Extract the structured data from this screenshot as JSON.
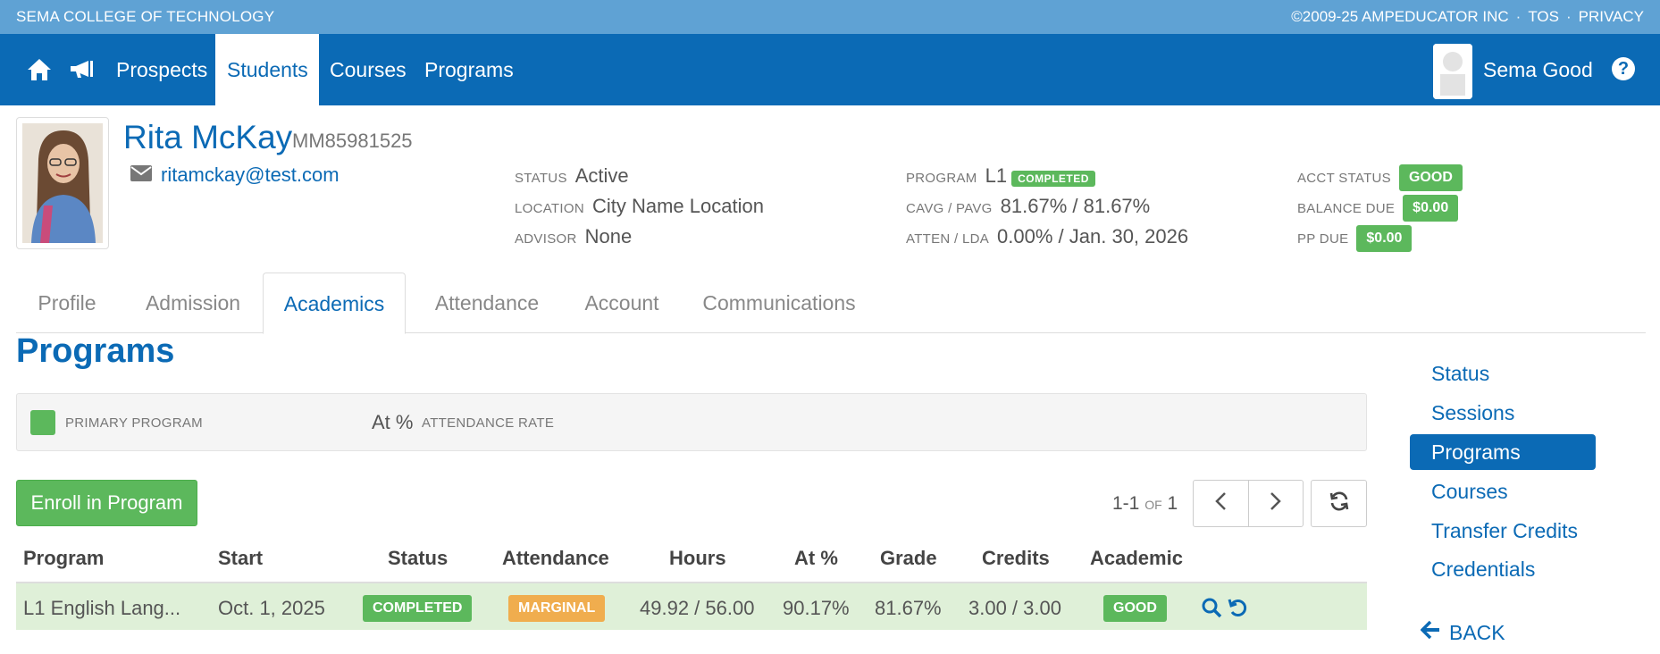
{
  "topbar": {
    "brand": "SEMA COLLEGE OF TECHNOLOGY",
    "copyright": "©2009-25 AMPEDUCATOR INC",
    "tos": "TOS",
    "privacy": "PRIVACY",
    "separator": "·"
  },
  "nav": {
    "items": [
      "Prospects",
      "Students",
      "Courses",
      "Programs"
    ],
    "active": "Students",
    "user_name": "Sema Good",
    "help": "?"
  },
  "student": {
    "name": "Rita McKay",
    "id": "MM85981525",
    "email": "ritamckay@test.com"
  },
  "info": {
    "status_label": "STATUS",
    "status_value": "Active",
    "location_label": "LOCATION",
    "location_value": "City Name Location",
    "advisor_label": "ADVISOR",
    "advisor_value": "None",
    "program_label": "PROGRAM",
    "program_value": "L1",
    "program_badge": "COMPLETED",
    "cavg_label": "CAVG / PAVG",
    "cavg_value": "81.67% / 81.67%",
    "atten_label": "ATTEN / LDA",
    "atten_value": "0.00% / Jan. 30, 2026",
    "acct_status_label": "ACCT STATUS",
    "acct_status_value": "GOOD",
    "balance_due_label": "BALANCE DUE",
    "balance_due_value": "$0.00",
    "pp_due_label": "PP DUE",
    "pp_due_value": "$0.00"
  },
  "tabs": [
    "Profile",
    "Admission",
    "Academics",
    "Attendance",
    "Account",
    "Communications"
  ],
  "active_tab": "Academics",
  "section_title": "Programs",
  "legend": {
    "primary_label": "PRIMARY PROGRAM",
    "at_value": "At %",
    "at_label": "ATTENDANCE RATE"
  },
  "enroll_button": "Enroll in Program",
  "pager": {
    "range": "1-1",
    "of": "OF",
    "total": "1"
  },
  "table": {
    "headers": [
      "Program",
      "Start",
      "Status",
      "Attendance",
      "Hours",
      "At %",
      "Grade",
      "Credits",
      "Academic"
    ],
    "rows": [
      {
        "program": "L1 English Lang...",
        "start": "Oct. 1, 2025",
        "status": "COMPLETED",
        "attendance": "MARGINAL",
        "hours": "49.92 / 56.00",
        "at_pct": "90.17%",
        "grade": "81.67%",
        "credits": "3.00 / 3.00",
        "academic": "GOOD"
      }
    ]
  },
  "side_nav": {
    "items": [
      "Status",
      "Sessions",
      "Programs",
      "Courses",
      "Transfer Credits",
      "Credentials"
    ],
    "active": "Programs",
    "back": "BACK"
  },
  "colors": {
    "primary_blue": "#0b6ab5",
    "top_strip": "#5fa2d4",
    "success_green": "#5cb85c",
    "warning_orange": "#f0ad4e",
    "row_highlight": "#dff0d8"
  }
}
